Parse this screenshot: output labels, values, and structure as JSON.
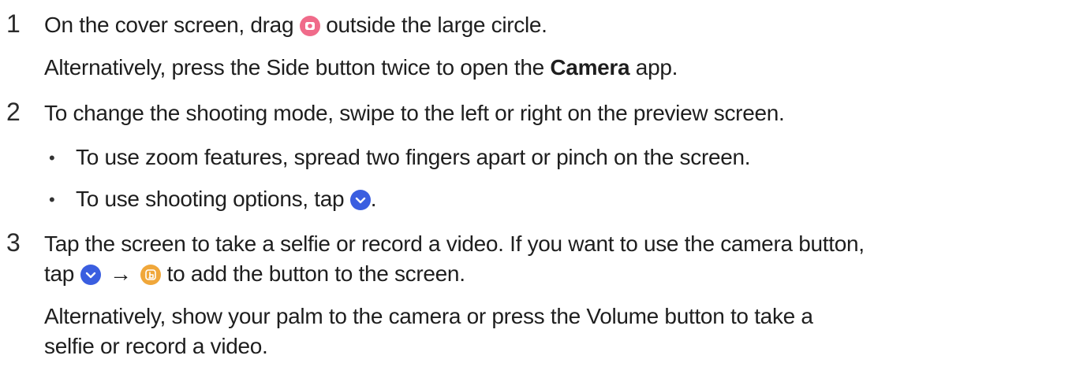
{
  "steps": [
    {
      "number": "1",
      "lines": {
        "l1_a": "On the cover screen, drag",
        "l1_b": "outside the large circle.",
        "l2_a": "Alternatively, press the Side button twice to open the",
        "l2_bold": "Camera",
        "l2_b": "app."
      },
      "icons": [
        "camera-icon"
      ]
    },
    {
      "number": "2",
      "lines": {
        "l1": "To change the shooting mode, swipe to the left or right on the preview screen."
      },
      "bullets": [
        {
          "text": "To use zoom features, spread two fingers apart or pinch on the screen."
        },
        {
          "text_a": "To use shooting options, tap",
          "text_b": "."
        }
      ],
      "icons": [
        "chevron-down-icon"
      ]
    },
    {
      "number": "3",
      "lines": {
        "l1": "Tap the screen to take a selfie or record a video. If you want to use the camera button,",
        "l2_a": "tap",
        "l2_arrow": "→",
        "l2_b": "to add the button to the screen.",
        "l3": "Alternatively, show your palm to the camera or press the Volume button to take a",
        "l4": "selfie or record a video."
      },
      "icons": [
        "chevron-down-icon",
        "hand-tap-icon"
      ]
    }
  ],
  "bullet_char": "•",
  "colors": {
    "text": "#1e1e1e",
    "camera_icon_bg": "#f06b8a",
    "chevron_icon_bg": "#3a5ee0",
    "hand_icon_bg": "#f0a73a"
  }
}
